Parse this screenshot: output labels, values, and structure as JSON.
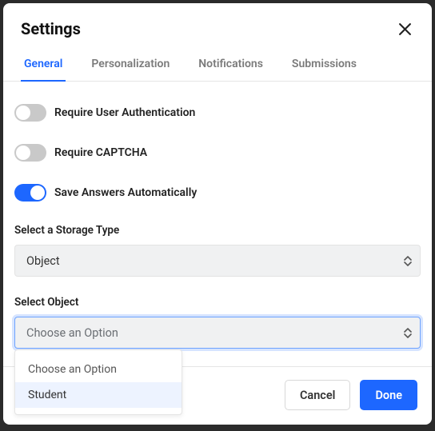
{
  "modal": {
    "title": "Settings"
  },
  "tabs": {
    "general": "General",
    "personalization": "Personalization",
    "notifications": "Notifications",
    "submissions": "Submissions"
  },
  "toggles": {
    "require_auth": {
      "label": "Require User Authentication",
      "on": false
    },
    "require_captcha": {
      "label": "Require CAPTCHA",
      "on": false
    },
    "save_answers": {
      "label": "Save Answers Automatically",
      "on": true
    }
  },
  "storage": {
    "label": "Select a Storage Type",
    "value": "Object"
  },
  "object": {
    "label": "Select Object",
    "placeholder": "Choose an Option",
    "options": [
      "Choose an Option",
      "Student"
    ]
  },
  "footer": {
    "cancel": "Cancel",
    "done": "Done"
  }
}
